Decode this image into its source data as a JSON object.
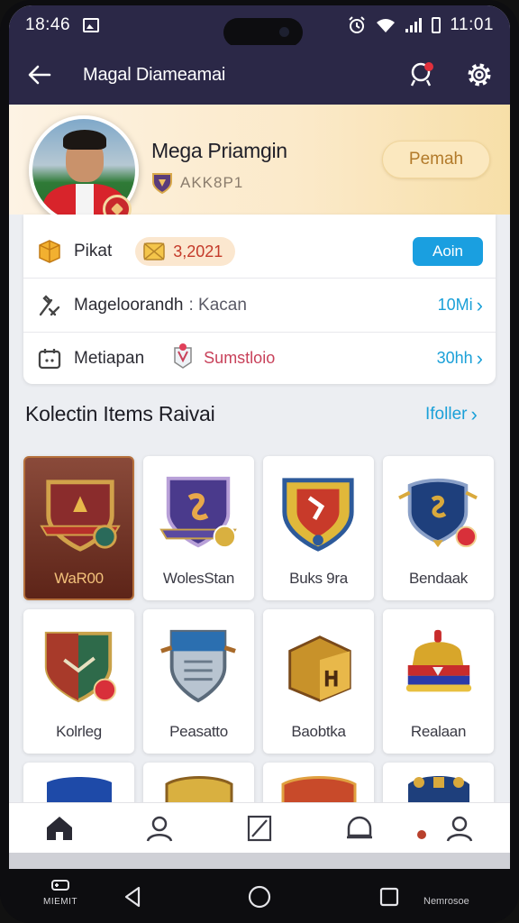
{
  "status_bar": {
    "time_left": "18:46",
    "time_right": "11:01"
  },
  "app_bar": {
    "title": "Magal Diameamai",
    "back_icon": "arrow-left-icon",
    "actions": [
      "notification-icon",
      "settings-icon"
    ]
  },
  "profile": {
    "name": "Mega Priamgin",
    "rank": "AKK8P1",
    "button_label": "Pemah"
  },
  "info_rows": {
    "coins": {
      "label": "Pikat",
      "value": "3,2021",
      "button_label": "Aoin"
    },
    "level": {
      "label": "Mageloorandh",
      "sub": ": Kacan",
      "value": "10Mi"
    },
    "rewards": {
      "label": "Metiapan",
      "tag": "Sumstloio",
      "value": "30hh"
    }
  },
  "collection": {
    "title": "Kolectin Items  Raivai",
    "link_label": "Ifoller",
    "items": [
      {
        "label": "WaR00",
        "colors": [
          "#8a2c2c",
          "#d1a24a"
        ]
      },
      {
        "label": "WolesStan",
        "colors": [
          "#4a3a8c",
          "#c9a24a"
        ]
      },
      {
        "label": "Buks 9ra",
        "colors": [
          "#2d5a9a",
          "#e0b83a"
        ]
      },
      {
        "label": "Bendaak",
        "colors": [
          "#1e3f7c",
          "#d9a93c"
        ]
      },
      {
        "label": "Kolrleg",
        "colors": [
          "#2e6a4a",
          "#a83a2a"
        ]
      },
      {
        "label": "Peasatto",
        "colors": [
          "#2b6fb0",
          "#b8c4d0"
        ]
      },
      {
        "label": "Baobtka",
        "colors": [
          "#c8922a",
          "#7a4a1a"
        ]
      },
      {
        "label": "Realaan",
        "colors": [
          "#d8a62a",
          "#c82c2c"
        ]
      }
    ]
  },
  "bottom_nav": [
    "home-icon",
    "profile-icon",
    "edit-icon",
    "chat-icon",
    "account-icon"
  ],
  "system_nav": {
    "left_label": "MIEMIT",
    "right_label": "Nemrosoe"
  }
}
